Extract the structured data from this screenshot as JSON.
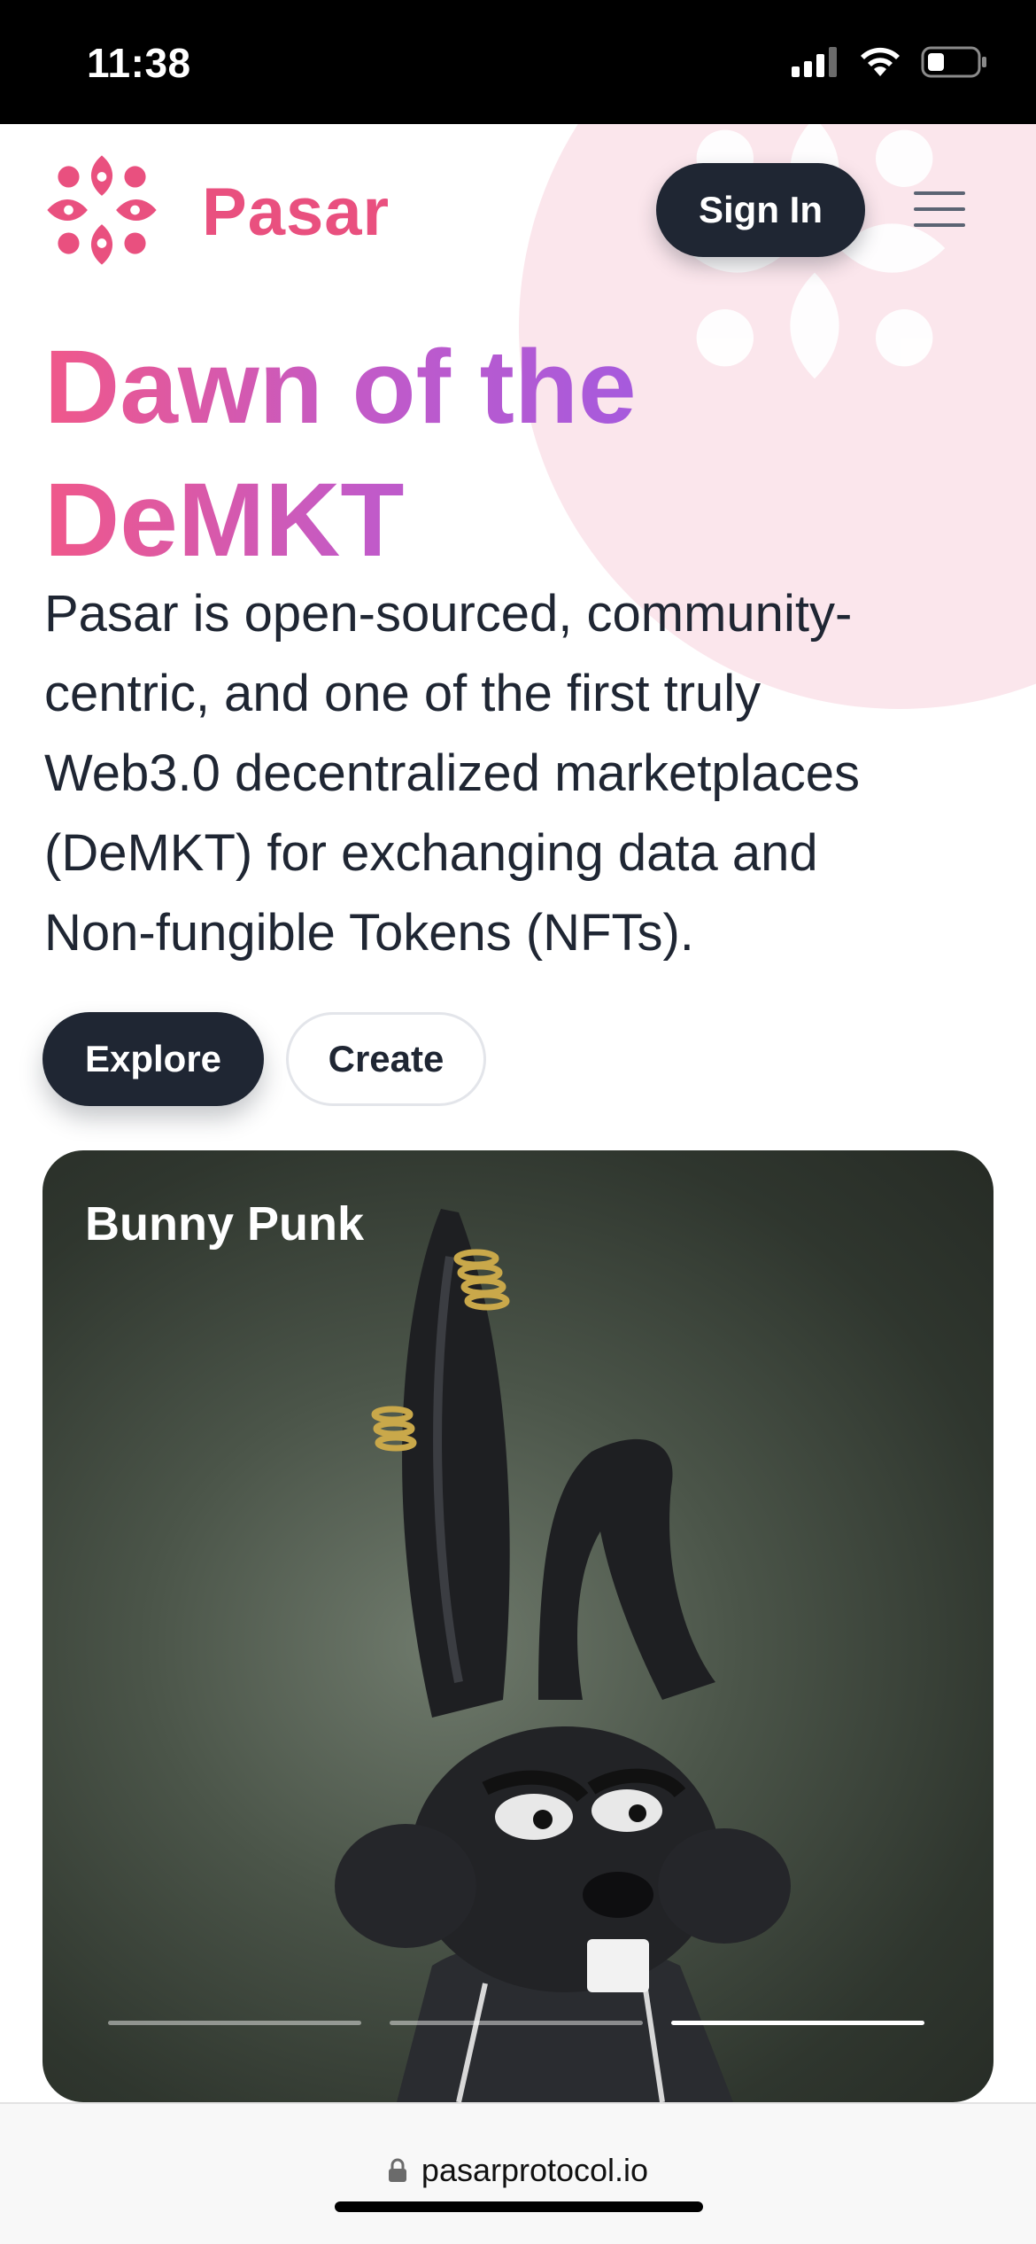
{
  "status_bar": {
    "time": "11:38",
    "icons": [
      "signal-icon",
      "wifi-icon",
      "battery-icon"
    ]
  },
  "header": {
    "logo_text": "Pasar",
    "sign_in_label": "Sign In",
    "menu_icon": "hamburger-menu-icon",
    "brand_color": "#e9507f"
  },
  "hero": {
    "title_line1": "Dawn of the",
    "title_line2": "DeMKT",
    "description": "Pasar is open-sourced, community-centric, and one of the first truly Web3.0 decentralized marketplaces (DeMKT) for exchanging data and Non-fungible Tokens (NFTs).",
    "gradient_colors": [
      "#f0588a",
      "#c25ac8",
      "#9a5ae6"
    ]
  },
  "actions": {
    "explore_label": "Explore",
    "create_label": "Create"
  },
  "featured": {
    "title": "Bunny Punk",
    "slides_total": 3,
    "active_slide": 3
  },
  "browser": {
    "url": "pasarprotocol.io",
    "lock_icon": "lock-icon"
  },
  "colors": {
    "dark": "#1f2633",
    "accent_pink": "#e9507f",
    "bg_pink": "#fbe6ec"
  }
}
